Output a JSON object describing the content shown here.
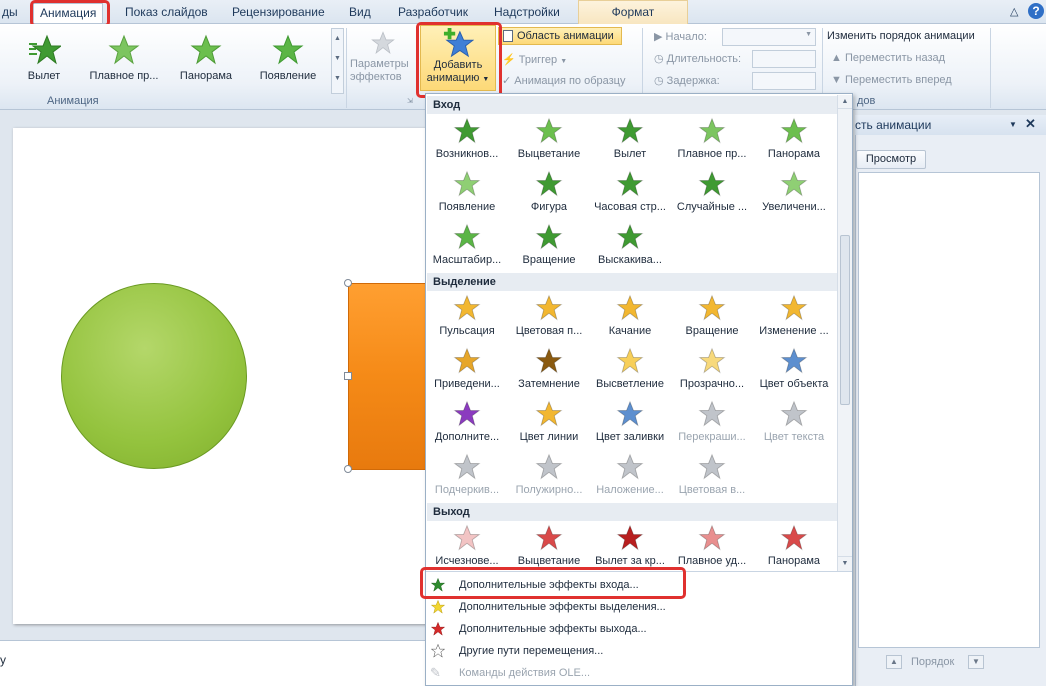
{
  "tabs": {
    "partial_left": "ды",
    "animation": "Анимация",
    "slideshow": "Показ слайдов",
    "review": "Рецензирование",
    "view": "Вид",
    "developer": "Разработчик",
    "addins": "Надстройки",
    "format": "Формат"
  },
  "ribbon": {
    "gallery": [
      {
        "label": "Вылет",
        "icon": "star-fly-icon"
      },
      {
        "label": "Плавное пр...",
        "icon": "star-fade-icon"
      },
      {
        "label": "Панорама",
        "icon": "star-pan-icon"
      },
      {
        "label": "Появление",
        "icon": "star-appear-icon"
      }
    ],
    "effect_params": "Параметры эффектов",
    "effect_params_line1": "Параметры",
    "effect_params_line2": "эффектов",
    "add_animation_line1": "Добавить",
    "add_animation_line2": "анимацию",
    "animation_pane": "Область анимации",
    "trigger": "Триггер",
    "animation_painter": "Анимация по образцу",
    "start_label": "Начало:",
    "duration_label": "Длительность:",
    "delay_label": "Задержка:",
    "reorder_title": "Изменить порядок анимации",
    "move_earlier": "Переместить назад",
    "move_later": "Переместить вперед",
    "group_animation": "Анимация",
    "group_timing_partial": "дов"
  },
  "panel": {
    "title": "сть анимации",
    "preview_button": "Просмотр",
    "order_label": "Порядок"
  },
  "menu": {
    "sections": {
      "entrance": "Вход",
      "emphasis": "Выделение",
      "exit": "Выход"
    },
    "entrance": [
      {
        "label": "Возникнов...",
        "color": "#3f9a32"
      },
      {
        "label": "Выцветание",
        "color": "#6cbf4e"
      },
      {
        "label": "Вылет",
        "color": "#3f9a32"
      },
      {
        "label": "Плавное пр...",
        "color": "#7cc560"
      },
      {
        "label": "Панорама",
        "color": "#6cbf4e"
      },
      {
        "label": "Появление",
        "color": "#8fcf74"
      },
      {
        "label": "Фигура",
        "color": "#3f9a32"
      },
      {
        "label": "Часовая стр...",
        "color": "#3f9a32"
      },
      {
        "label": "Случайные ...",
        "color": "#3f9a32"
      },
      {
        "label": "Увеличени...",
        "color": "#8fcf74"
      },
      {
        "label": "Масштабир...",
        "color": "#5bb546"
      },
      {
        "label": "Вращение",
        "color": "#3f9a32"
      },
      {
        "label": "Выскакива...",
        "color": "#3f9a32"
      }
    ],
    "emphasis": [
      {
        "label": "Пульсация",
        "color": "#f2b731",
        "disabled": false
      },
      {
        "label": "Цветовая п...",
        "color": "#f2b731",
        "disabled": false
      },
      {
        "label": "Качание",
        "color": "#f2b731",
        "disabled": false
      },
      {
        "label": "Вращение",
        "color": "#f2b731",
        "disabled": false
      },
      {
        "label": "Изменение ...",
        "color": "#f2b731",
        "disabled": false
      },
      {
        "label": "Приведени...",
        "color": "#e6a62a",
        "disabled": false
      },
      {
        "label": "Затемнение",
        "color": "#8a5a10",
        "disabled": false
      },
      {
        "label": "Высветление",
        "color": "#f7cf5a",
        "disabled": false
      },
      {
        "label": "Прозрачно...",
        "color": "#f7d97c",
        "disabled": false
      },
      {
        "label": "Цвет объекта",
        "color": "#5d8fcf",
        "disabled": false
      },
      {
        "label": "Дополните...",
        "color": "#8b3bbf",
        "disabled": false
      },
      {
        "label": "Цвет линии",
        "color": "#f2b731",
        "disabled": false
      },
      {
        "label": "Цвет заливки",
        "color": "#5d8fcf",
        "disabled": false
      },
      {
        "label": "Перекраши...",
        "color": "#c0c4ca",
        "disabled": true
      },
      {
        "label": "Цвет текста",
        "color": "#c0c4ca",
        "disabled": true
      },
      {
        "label": "Подчеркив...",
        "color": "#c0c4ca",
        "disabled": true
      },
      {
        "label": "Полужирно...",
        "color": "#c0c4ca",
        "disabled": true
      },
      {
        "label": "Наложение...",
        "color": "#c0c4ca",
        "disabled": true
      },
      {
        "label": "Цветовая в...",
        "color": "#c0c4ca",
        "disabled": true
      }
    ],
    "exit": [
      {
        "label": "Исчезнове...",
        "color": "#f2c4c4"
      },
      {
        "label": "Выцветание",
        "color": "#d94a4a"
      },
      {
        "label": "Вылет за кр...",
        "color": "#b81f1f"
      },
      {
        "label": "Плавное уд...",
        "color": "#e88f8f"
      },
      {
        "label": "Панорама",
        "color": "#d94a4a"
      }
    ],
    "more": [
      {
        "label": "Дополнительные эффекты входа...",
        "disabled": false
      },
      {
        "label": "Дополнительные эффекты выделения...",
        "disabled": false
      },
      {
        "label": "Дополнительные эффекты выхода...",
        "disabled": false
      },
      {
        "label": "Другие пути перемещения...",
        "disabled": false
      },
      {
        "label": "Команды действия OLE...",
        "disabled": true
      }
    ]
  },
  "notes_partial": "у",
  "colors": {
    "highlight_red": "#e0312f",
    "add_button_bg": "#fde59a",
    "circle_green": "#94c33e",
    "rect_orange": "#f58a17"
  }
}
